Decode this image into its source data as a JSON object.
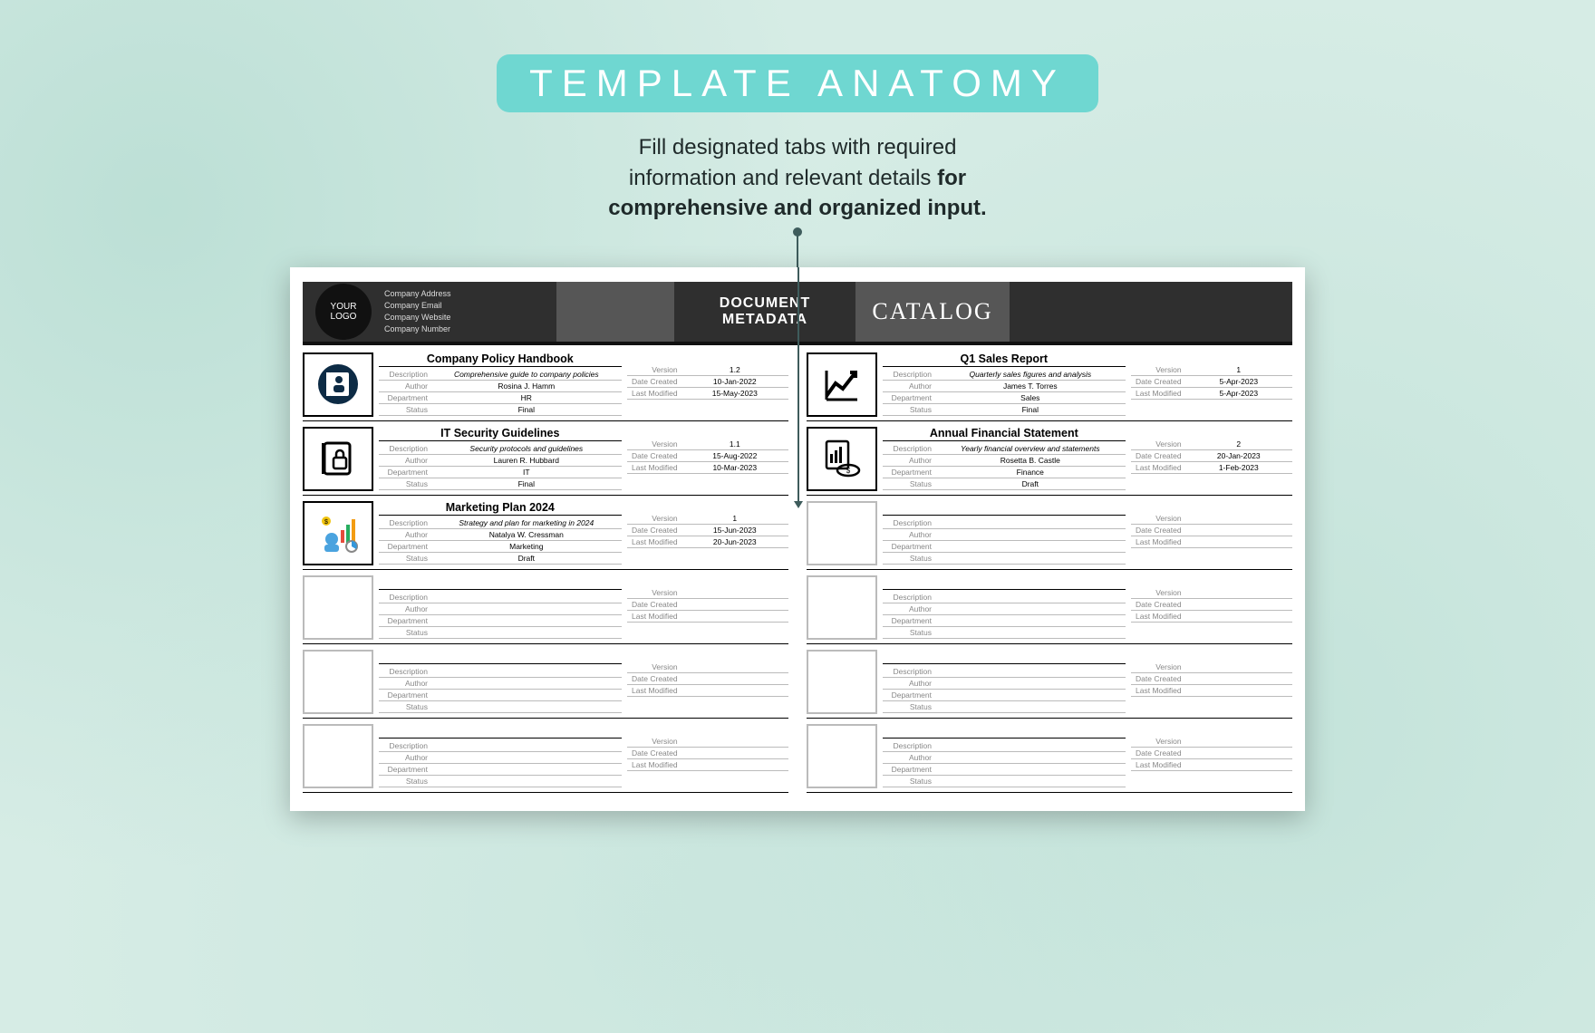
{
  "title_badge": "TEMPLATE ANATOMY",
  "subtitle": {
    "line1": "Fill designated tabs with required",
    "line2a": "information and relevant details ",
    "line2b": "for",
    "line3": "comprehensive and organized input."
  },
  "header": {
    "logo_line1": "YOUR",
    "logo_line2": "LOGO",
    "company_fields": [
      "Company Address",
      "Company Email",
      "Company Website",
      "Company Number"
    ],
    "doc_title_line1": "DOCUMENT",
    "doc_title_line2": "METADATA",
    "catalog": "CATALOG"
  },
  "labels": {
    "description": "Description",
    "author": "Author",
    "department": "Department",
    "status": "Status",
    "version": "Version",
    "date_created": "Date Created",
    "last_modified": "Last Modified"
  },
  "cards": [
    {
      "icon": "handbook",
      "title": "Company Policy Handbook",
      "description": "Comprehensive guide to company policies",
      "author": "Rosina J. Hamm",
      "department": "HR",
      "status": "Final",
      "version": "1.2",
      "date_created": "10-Jan-2022",
      "last_modified": "15-May-2023"
    },
    {
      "icon": "chart",
      "title": "Q1 Sales Report",
      "description": "Quarterly sales figures and analysis",
      "author": "James T. Torres",
      "department": "Sales",
      "status": "Final",
      "version": "1",
      "date_created": "5-Apr-2023",
      "last_modified": "5-Apr-2023"
    },
    {
      "icon": "security",
      "title": "IT Security Guidelines",
      "description": "Security protocols and guidelines",
      "author": "Lauren R. Hubbard",
      "department": "IT",
      "status": "Final",
      "version": "1.1",
      "date_created": "15-Aug-2022",
      "last_modified": "10-Mar-2023"
    },
    {
      "icon": "finance",
      "title": "Annual Financial Statement",
      "description": "Yearly financial overview and statements",
      "author": "Rosetta B. Castle",
      "department": "Finance",
      "status": "Draft",
      "version": "2",
      "date_created": "20-Jan-2023",
      "last_modified": "1-Feb-2023"
    },
    {
      "icon": "marketing",
      "title": "Marketing Plan 2024",
      "description": "Strategy and plan for marketing in 2024",
      "author": "Natalya W. Cressman",
      "department": "Marketing",
      "status": "Draft",
      "version": "1",
      "date_created": "15-Jun-2023",
      "last_modified": "20-Jun-2023"
    },
    {
      "empty": true
    },
    {
      "empty": true
    },
    {
      "empty": true
    },
    {
      "empty": true
    },
    {
      "empty": true
    },
    {
      "empty": true
    },
    {
      "empty": true
    }
  ]
}
